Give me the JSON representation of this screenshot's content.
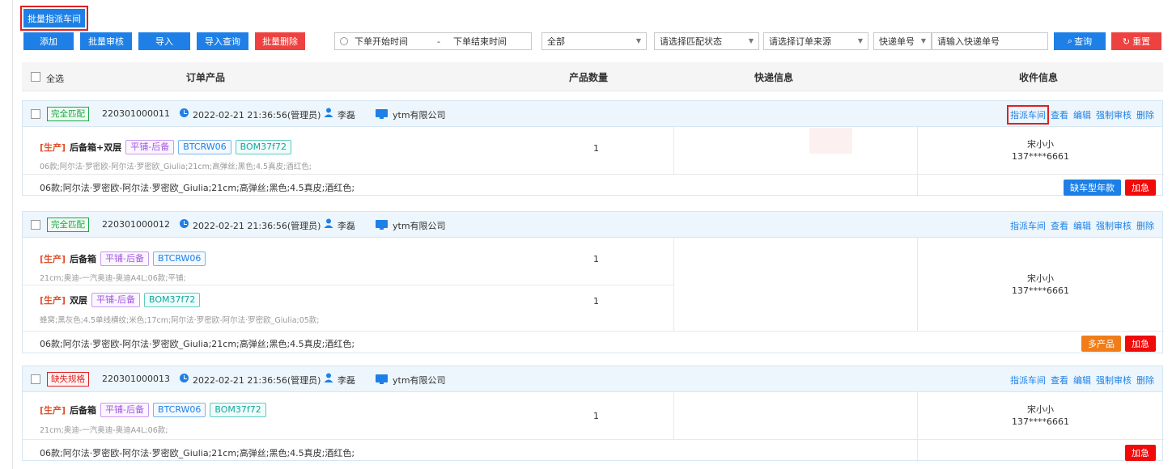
{
  "toolbar": {
    "batch_assign": "批量指派车间",
    "add": "添加",
    "batch_review": "批量审核",
    "import": "导入",
    "import_query": "导入查询",
    "batch_delete": "批量删除",
    "date_start": "下单开始时间",
    "date_sep": "-",
    "date_end": "下单结束时间",
    "filter_all": "全部",
    "match_status_placeholder": "请选择匹配状态",
    "order_source_placeholder": "请选择订单来源",
    "express_type": "快递单号",
    "express_placeholder": "请输入快递单号",
    "query": "查询",
    "reset": "重置"
  },
  "table_header": {
    "select_all": "全选",
    "col_product": "订单产品",
    "col_qty": "产品数量",
    "col_express": "快递信息",
    "col_receiver": "收件信息"
  },
  "orders": [
    {
      "status": "完全匹配",
      "order_no": "220301000011",
      "time": "2022-02-21 21:36:56(管理员)",
      "user": "李磊",
      "company": "ytm有限公司",
      "actions": [
        "指派车间",
        "查看",
        "编辑",
        "强制审核",
        "删除"
      ],
      "products": [
        {
          "prefix": "[生产]",
          "name": "后备箱+双层",
          "tags": [
            "平铺-后备",
            "BTCRW06",
            "BOM37f72"
          ],
          "desc": "06款;阿尔法·罗密欧-阿尔法·罗密欧_Giulia;21cm;高弹丝;黑色;4.5真皮;酒红色;",
          "qty": "1"
        }
      ],
      "receiver_name": "宋小小",
      "receiver_phone": "137****6661",
      "footer": "06款;阿尔法·罗密欧-阿尔法·罗密欧_Giulia;21cm;高弹丝;黑色;4.5真皮;酒红色;",
      "badges": [
        "缺车型年款",
        "加急"
      ]
    },
    {
      "status": "完全匹配",
      "order_no": "220301000012",
      "time": "2022-02-21 21:36:56(管理员)",
      "user": "李磊",
      "company": "ytm有限公司",
      "actions": [
        "指派车间",
        "查看",
        "编辑",
        "强制审核",
        "删除"
      ],
      "products": [
        {
          "prefix": "[生产]",
          "name": "后备箱",
          "tags": [
            "平铺-后备",
            "BTCRW06"
          ],
          "desc": "21cm;奥迪-一汽奥迪-奥迪A4L;06款;平铺;",
          "qty": "1"
        },
        {
          "prefix": "[生产]",
          "name": "双层",
          "tags": [
            "平铺-后备",
            "BOM37f72"
          ],
          "desc": "蜂窝;黑灰色;4.5单线横纹;米色;17cm;阿尔法·罗密欧-阿尔法·罗密欧_Giulia;05款;",
          "qty": "1"
        }
      ],
      "receiver_name": "宋小小",
      "receiver_phone": "137****6661",
      "footer": "06款;阿尔法·罗密欧-阿尔法·罗密欧_Giulia;21cm;高弹丝;黑色;4.5真皮;酒红色;",
      "badges": [
        "多产品",
        "加急"
      ]
    },
    {
      "status": "缺失规格",
      "order_no": "220301000013",
      "time": "2022-02-21 21:36:56(管理员)",
      "user": "李磊",
      "company": "ytm有限公司",
      "actions": [
        "指派车间",
        "查看",
        "编辑",
        "强制审核",
        "删除"
      ],
      "products": [
        {
          "prefix": "[生产]",
          "name": "后备箱",
          "tags": [
            "平铺-后备",
            "BTCRW06",
            "BOM37f72"
          ],
          "desc": "21cm;奥迪-一汽奥迪-奥迪A4L;06款;",
          "qty": "1"
        }
      ],
      "receiver_name": "宋小小",
      "receiver_phone": "137****6661",
      "footer": "06款;阿尔法·罗密欧-阿尔法·罗密欧_Giulia;21cm;高弹丝;黑色;4.5真皮;酒红色;",
      "badges": [
        "加急"
      ]
    }
  ],
  "colors": {
    "primary": "#1e80e6",
    "danger": "#ed4240",
    "urgent": "#f00a0a",
    "orange": "#f07d1a",
    "match": "#1aa845"
  }
}
